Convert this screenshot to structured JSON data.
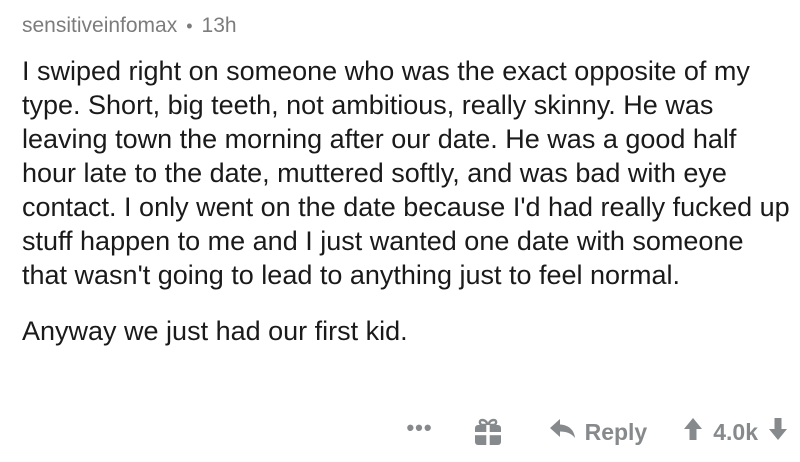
{
  "comment": {
    "username": "sensitiveinfomax",
    "separator": "•",
    "age": "13h",
    "paragraphs": [
      "I swiped right on someone who was the exact opposite of my type. Short, big teeth, not ambitious, really skinny. He was leaving town the morning after our date. He was a good half hour late to the date, muttered softly, and was bad with eye contact. I only went on the date because I'd had really fucked up stuff happen to me and I just wanted one date with someone that wasn't going to lead to anything just to feel normal.",
      "Anyway we just had our first kid."
    ]
  },
  "actions": {
    "more": "•••",
    "more_icon": "more-options-icon",
    "award_icon": "gift-icon",
    "reply_label": "Reply",
    "reply_icon": "reply-arrow-icon",
    "score": "4.0k",
    "upvote_icon": "upvote-arrow-icon",
    "downvote_icon": "downvote-arrow-icon"
  },
  "colors": {
    "meta_text": "#7c7c7c",
    "body_text": "#1a1a1b",
    "action_gray": "#878a8c"
  }
}
